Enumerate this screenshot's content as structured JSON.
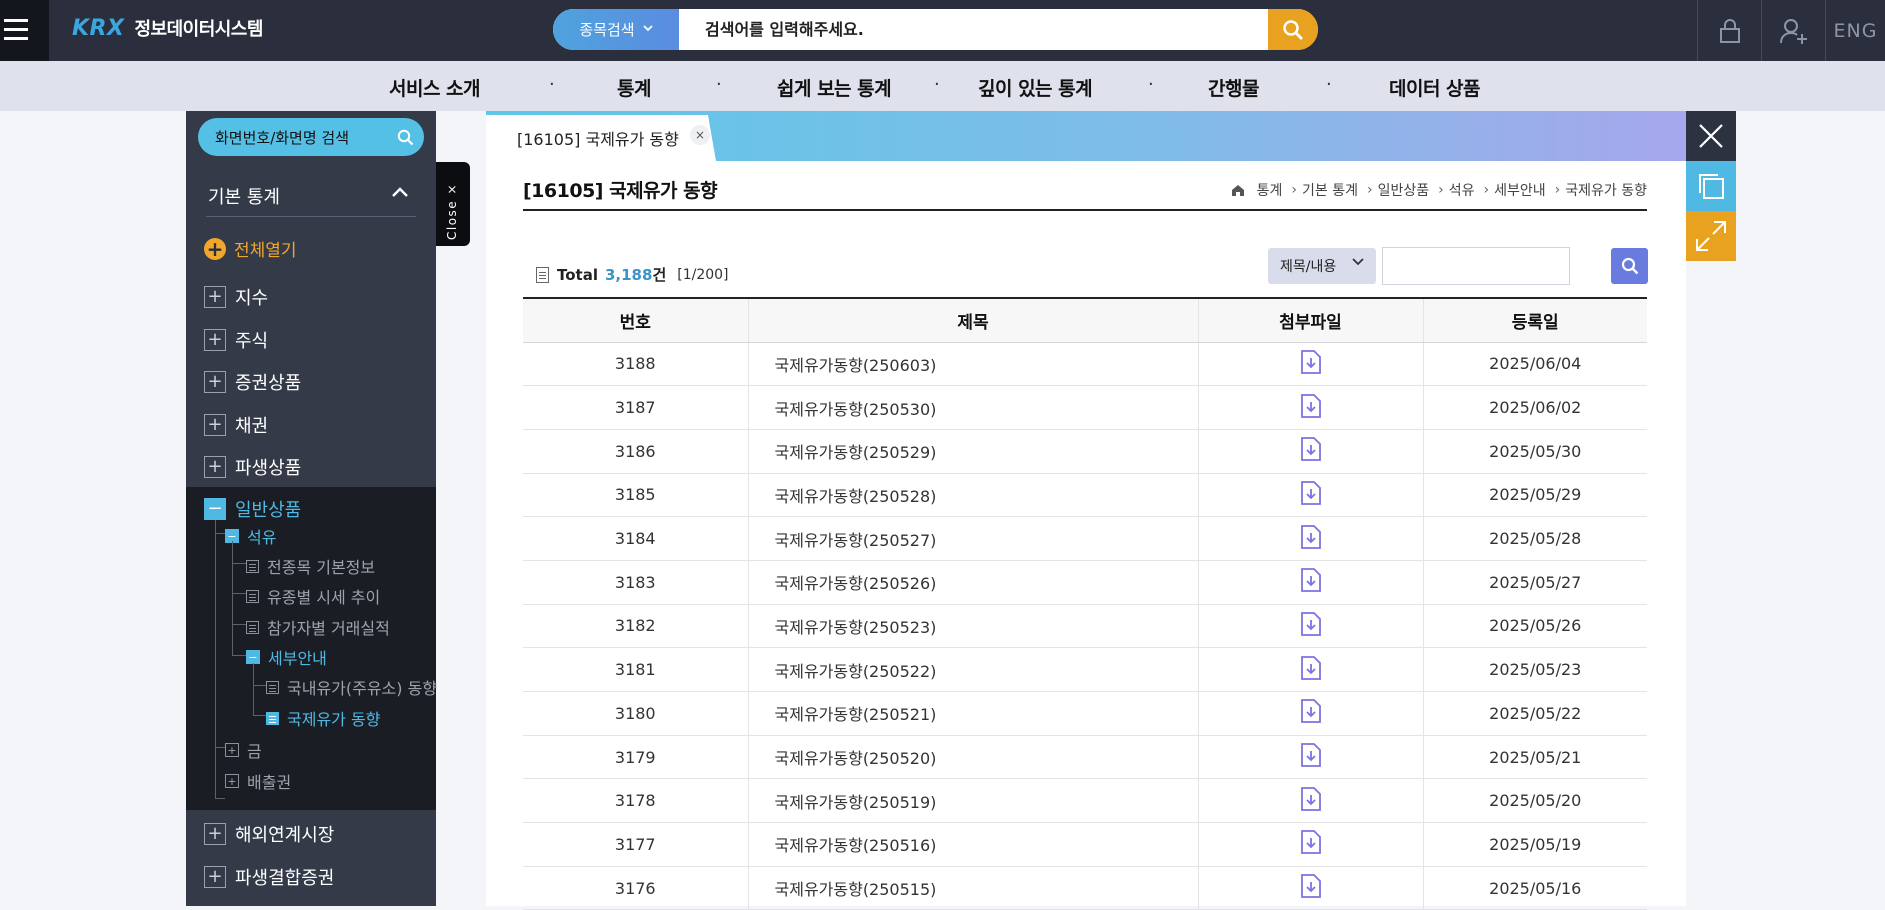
{
  "header": {
    "logo_text": "KRX",
    "system_name": "정보데이터시스템",
    "search_type_label": "종목검색",
    "search_placeholder": "검색어를 입력해주세요.",
    "lang_label": "ENG",
    "icons": [
      "menu-icon",
      "search-icon",
      "lock-icon",
      "user-add-icon"
    ]
  },
  "nav": {
    "items": [
      "서비스 소개",
      "통계",
      "쉽게 보는 통계",
      "깊이 있는 통계",
      "간행물",
      "데이터 상품"
    ],
    "separator": "·"
  },
  "sidebar": {
    "search_label": "화면번호/화면명 검색",
    "section_title": "기본 통계",
    "open_all_label": "전체열기",
    "items": [
      {
        "label": "지수",
        "sign": "+"
      },
      {
        "label": "주식",
        "sign": "+"
      },
      {
        "label": "증권상품",
        "sign": "+"
      },
      {
        "label": "채권",
        "sign": "+"
      },
      {
        "label": "파생상품",
        "sign": "+"
      },
      {
        "label": "일반상품",
        "sign": "−"
      },
      {
        "label": "해외연계시장",
        "sign": "+"
      },
      {
        "label": "파생결합증권",
        "sign": "+"
      }
    ],
    "tree": {
      "oil": "석유",
      "oil_children": [
        "전종목 기본정보",
        "유종별 시세 추이",
        "참가자별 거래실적"
      ],
      "detail": "세부안내",
      "detail_children": [
        "국내유가(주유소) 동향",
        "국제유가 동향"
      ],
      "gold": "금",
      "emission": "배출권"
    },
    "close_label": "Close ×"
  },
  "content": {
    "tab_label": "[16105] 국제유가 동향",
    "tab_close": "×",
    "page_title": "[16105] 국제유가 동향",
    "breadcrumb": [
      "통계",
      "기본 통계",
      "일반상품",
      "석유",
      "세부안내",
      "국제유가 동향"
    ],
    "total_label": "Total",
    "total_count": "3,188",
    "total_unit": "건",
    "page_info": "[1/200]",
    "filter_select": "제목/내용",
    "filter_value": "",
    "table": {
      "headers": [
        "번호",
        "제목",
        "첨부파일",
        "등록일"
      ],
      "rows": [
        {
          "no": "3188",
          "title": "국제유가동향(250603)",
          "date": "2025/06/04"
        },
        {
          "no": "3187",
          "title": "국제유가동향(250530)",
          "date": "2025/06/02"
        },
        {
          "no": "3186",
          "title": "국제유가동향(250529)",
          "date": "2025/05/30"
        },
        {
          "no": "3185",
          "title": "국제유가동향(250528)",
          "date": "2025/05/29"
        },
        {
          "no": "3184",
          "title": "국제유가동향(250527)",
          "date": "2025/05/28"
        },
        {
          "no": "3183",
          "title": "국제유가동향(250526)",
          "date": "2025/05/27"
        },
        {
          "no": "3182",
          "title": "국제유가동향(250523)",
          "date": "2025/05/26"
        },
        {
          "no": "3181",
          "title": "국제유가동향(250522)",
          "date": "2025/05/23"
        },
        {
          "no": "3180",
          "title": "국제유가동향(250521)",
          "date": "2025/05/22"
        },
        {
          "no": "3179",
          "title": "국제유가동향(250520)",
          "date": "2025/05/21"
        },
        {
          "no": "3178",
          "title": "국제유가동향(250519)",
          "date": "2025/05/20"
        },
        {
          "no": "3177",
          "title": "국제유가동향(250516)",
          "date": "2025/05/19"
        },
        {
          "no": "3176",
          "title": "국제유가동향(250515)",
          "date": "2025/05/16"
        }
      ]
    }
  },
  "colors": {
    "topbar": "#2b2f3d",
    "accent_blue": "#4fb9e3",
    "accent_orange": "#e8a21f",
    "download_icon": "#7b73e0"
  }
}
